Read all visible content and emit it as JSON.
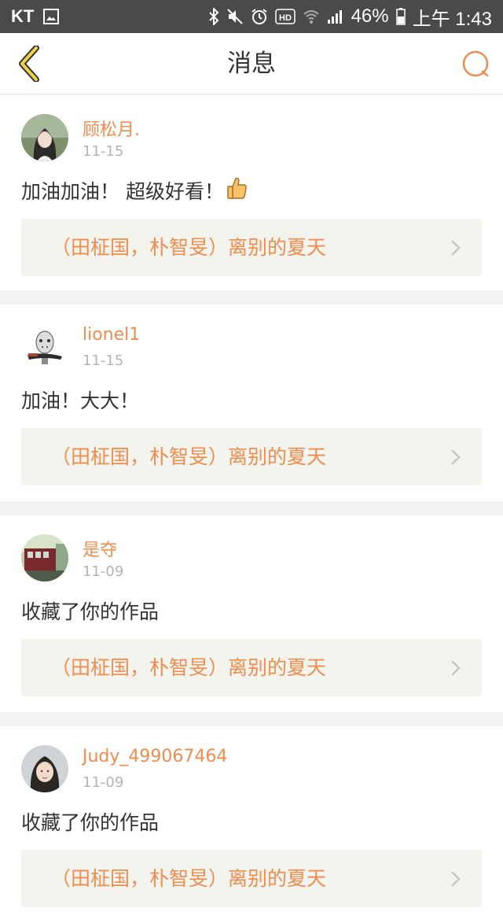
{
  "status_bar": {
    "carrier": "KT",
    "battery": "46%",
    "time": "上午 1:43"
  },
  "header": {
    "title": "消息"
  },
  "colors": {
    "accent": "#ef8c4e",
    "link_bg": "#f4f4ef",
    "status_bar": "#4a4a4a"
  },
  "messages": [
    {
      "username": "顾松月.",
      "date": "11-15",
      "text": "加油加油！ 超级好看！",
      "emoji": "thumbs-up",
      "work_title": "（田柾国，朴智旻）离别的夏天"
    },
    {
      "username": "lionel1",
      "date": "11-15",
      "text": "加油！大大！",
      "work_title": "（田柾国，朴智旻）离别的夏天"
    },
    {
      "username": "是夺",
      "date": "11-09",
      "text": "收藏了你的作品",
      "work_title": "（田柾国，朴智旻）离别的夏天"
    },
    {
      "username": "Judy_499067464",
      "date": "11-09",
      "text": "收藏了你的作品",
      "work_title": "（田柾国，朴智旻）离别的夏天"
    }
  ]
}
